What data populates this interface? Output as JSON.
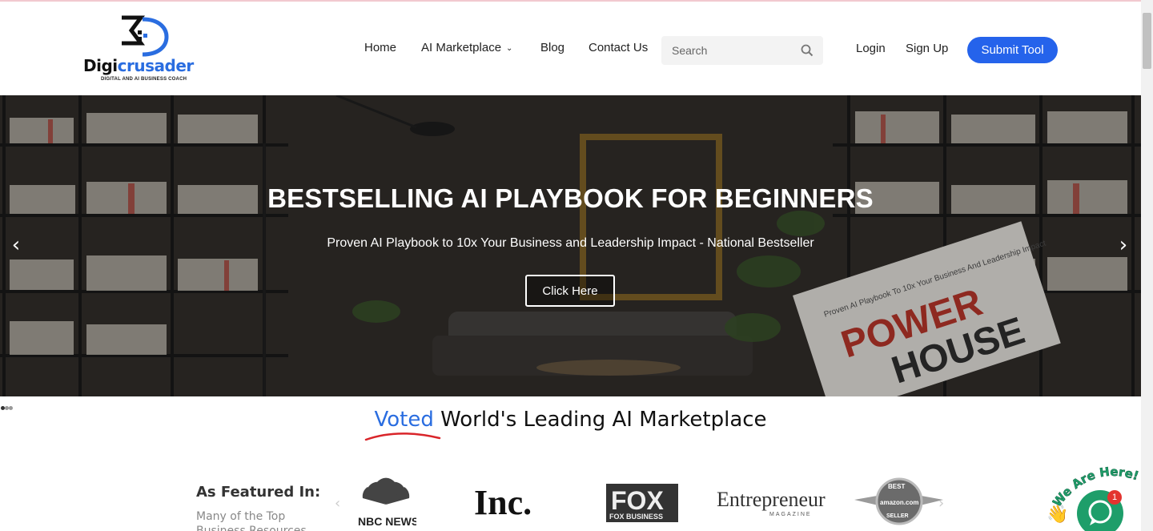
{
  "brand": {
    "name_part1": "Digi",
    "name_part2": "crusader",
    "tagline": "DIGITAL AND AI BUSINESS COACH"
  },
  "nav": {
    "home": "Home",
    "ai_marketplace": "AI Marketplace",
    "ai_marketplace_chevron": "⌄",
    "blog": "Blog",
    "contact": "Contact Us"
  },
  "search": {
    "placeholder": "Search",
    "icon": "search-icon"
  },
  "auth": {
    "login": "Login",
    "signup": "Sign Up",
    "submit_tool": "Submit Tool"
  },
  "colors": {
    "accent": "#2563eb",
    "brand_blue": "#2a6de0",
    "chat_green": "#1e9e6a",
    "badge_red": "#e3342f"
  },
  "hero": {
    "title": "BESTSELLING AI PLAYBOOK FOR BEGINNERS",
    "subtitle": "Proven AI Playbook to 10x Your Business and Leadership Impact - National Bestseller",
    "cta": "Click Here",
    "prev_arrow": "‹",
    "next_arrow": "›",
    "book_title_line1": "POWER",
    "book_title_line2": "HOUSE",
    "book_subtitle": "Proven AI Playbook To 10x Your Business And Leadership Impact"
  },
  "headline": {
    "highlight": "Voted",
    "rest": " World's Leading AI Marketplace"
  },
  "featured": {
    "title": "As Featured In:",
    "subtitle": "Many of the Top Business Resources",
    "logos": [
      "NBC NEWS",
      "Inc.",
      "FOX BUSINESS",
      "Entrepreneur",
      "MAGAZINE",
      "BEST",
      "amazon.com",
      "SELLER"
    ]
  },
  "chat": {
    "badge_count": "1",
    "callout": "We Are Here!"
  }
}
